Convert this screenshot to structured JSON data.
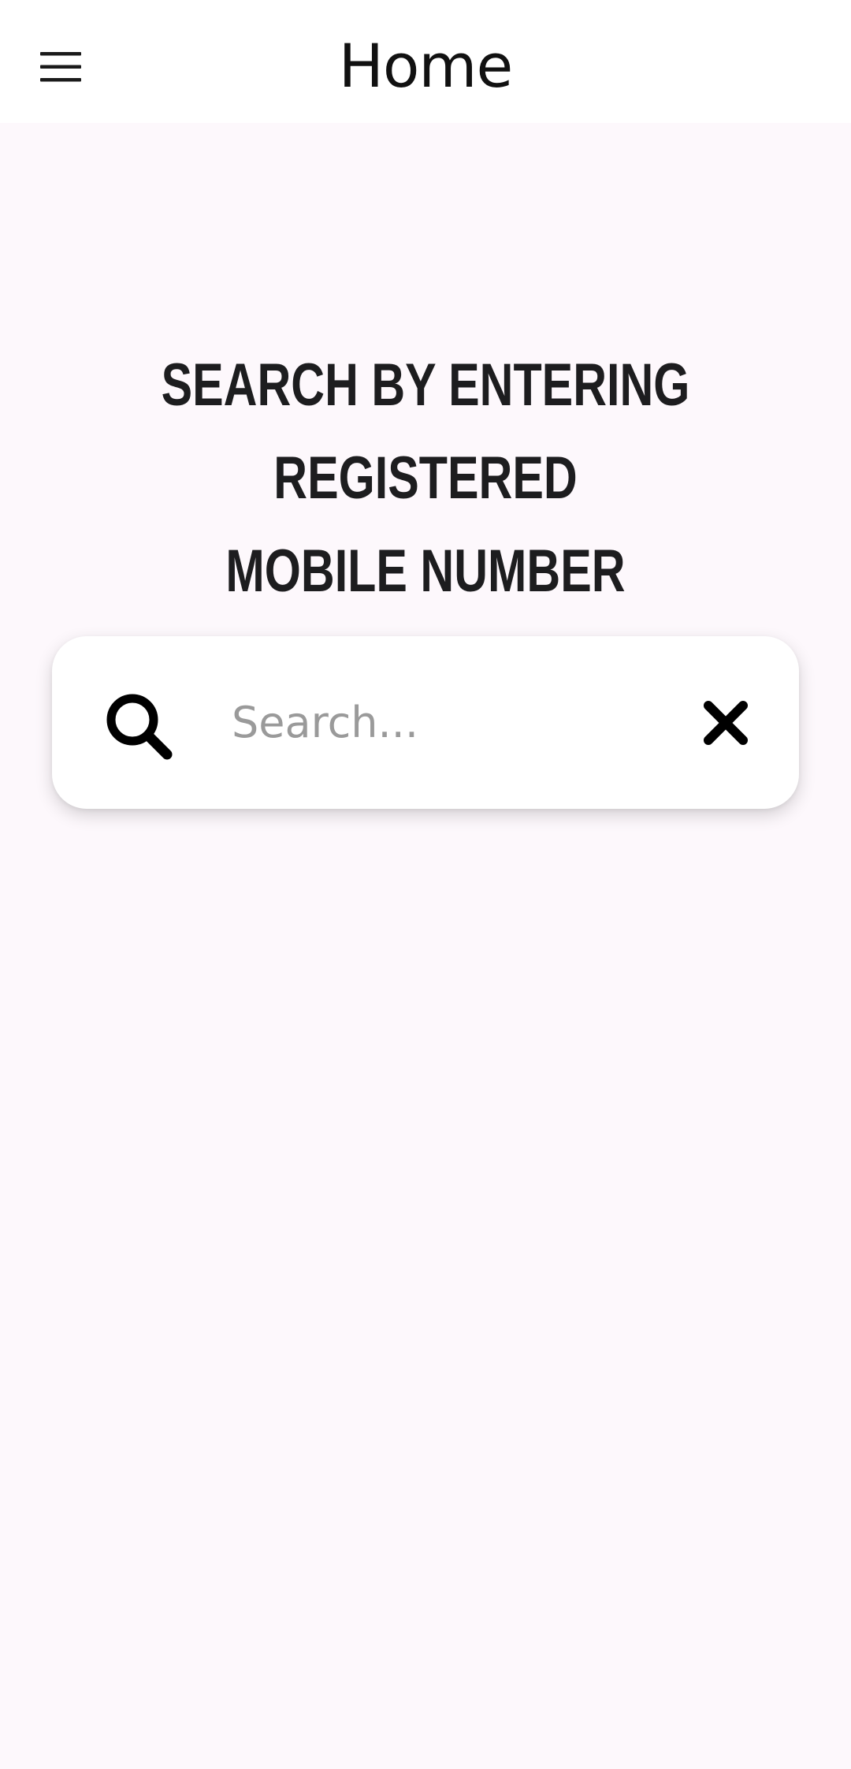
{
  "header": {
    "title": "Home",
    "menu_icon": "hamburger-menu-icon"
  },
  "main": {
    "heading_line1": "Search by entering registered",
    "heading_line2": "mobile number"
  },
  "search": {
    "value": "",
    "placeholder": "Search...",
    "search_icon": "magnifier-icon",
    "clear_icon": "close-x-icon"
  },
  "colors": {
    "background": "#fdf8fc",
    "app_bar": "#ffffff",
    "text": "#111111",
    "placeholder": "#9a9a9a"
  }
}
